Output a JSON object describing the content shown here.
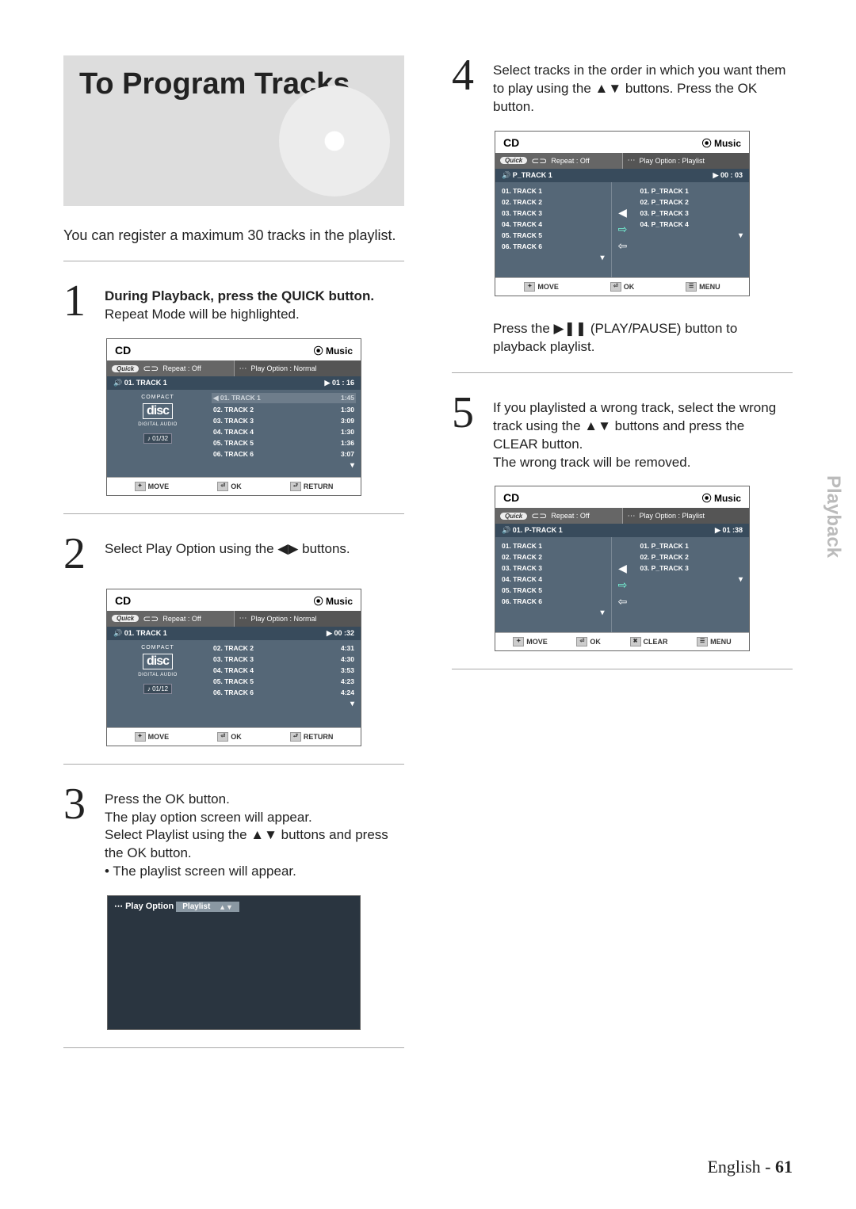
{
  "title": "To Program Tracks",
  "intro": "You can register a maximum 30 tracks in the playlist.",
  "sidetab": "Playback",
  "footer": {
    "lang": "English",
    "page": "61"
  },
  "steps": {
    "s1": {
      "num": "1",
      "bold": "During Playback, press the QUICK button.",
      "text": "Repeat Mode will be highlighted."
    },
    "s2": {
      "num": "2",
      "text": "Select Play Option using the ◀▶ buttons."
    },
    "s3": {
      "num": "3",
      "l1": "Press the OK button.",
      "l2": "The play option screen will appear.",
      "l3": "Select Playlist using the ▲▼ buttons and press the OK button.",
      "l4": "• The playlist screen will appear."
    },
    "s4": {
      "num": "4",
      "text": "Select tracks in the order in which you want them to play using the ▲▼ buttons. Press the OK button.",
      "after": "Press the ▶❚❚ (PLAY/PAUSE) button to playback playlist."
    },
    "s5": {
      "num": "5",
      "l1": "If you playlisted a wrong track, select the wrong track using the ▲▼ buttons and press the CLEAR button.",
      "l2": "The wrong track will be removed."
    }
  },
  "ui": {
    "cd": "CD",
    "music": "Music",
    "quick": "Quick",
    "repeat_off": "Repeat : Off",
    "play_opt_normal": "Play Option : Normal",
    "play_opt_playlist": "Play Option : Playlist",
    "move": "MOVE",
    "ok": "OK",
    "return": "RETURN",
    "menu": "MENU",
    "clear": "CLEAR",
    "compact": "COMPACT",
    "digital_audio": "DIGITAL AUDIO",
    "disc": "disc",
    "playopt_label": "Play Option",
    "playlist_sel": "Playlist"
  },
  "screen1": {
    "now": "01. TRACK 1",
    "time": "01 : 16",
    "count": "01/32",
    "rows": [
      {
        "t": "01. TRACK 1",
        "d": "1:45",
        "hl": true
      },
      {
        "t": "02. TRACK 2",
        "d": "1:30"
      },
      {
        "t": "03. TRACK 3",
        "d": "3:09"
      },
      {
        "t": "04. TRACK 4",
        "d": "1:30"
      },
      {
        "t": "05. TRACK 5",
        "d": "1:36"
      },
      {
        "t": "06. TRACK 6",
        "d": "3:07"
      }
    ]
  },
  "screen2": {
    "now": "01. TRACK 1",
    "time": "00 :32",
    "count": "01/12",
    "rows": [
      {
        "t": "02. TRACK 2",
        "d": "4:31"
      },
      {
        "t": "03. TRACK 3",
        "d": "4:30"
      },
      {
        "t": "04. TRACK 4",
        "d": "3:53"
      },
      {
        "t": "05. TRACK 5",
        "d": "4:23"
      },
      {
        "t": "06. TRACK 6",
        "d": "4:24"
      }
    ]
  },
  "screen4": {
    "now": "P_TRACK 1",
    "time": "00 : 03",
    "left": [
      "01. TRACK 1",
      "02. TRACK 2",
      "03. TRACK 3",
      "04. TRACK 4",
      "05. TRACK 5",
      "06. TRACK 6"
    ],
    "right": [
      "01. P_TRACK 1",
      "02. P_TRACK 2",
      "03. P_TRACK 3",
      "04. P_TRACK 4"
    ]
  },
  "screen5": {
    "now": "01. P-TRACK 1",
    "time": "01 :38",
    "left": [
      "01. TRACK 1",
      "02. TRACK 2",
      "03. TRACK 3",
      "04. TRACK 4",
      "05. TRACK 5",
      "06. TRACK 6"
    ],
    "right": [
      "01. P_TRACK 1",
      "02. P_TRACK 2",
      "03. P_TRACK 3"
    ]
  }
}
